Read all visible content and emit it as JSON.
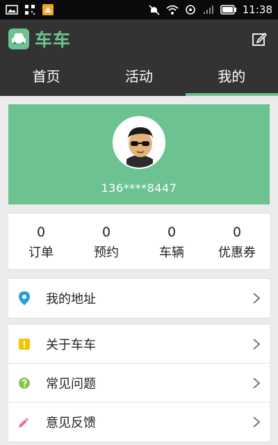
{
  "status_bar": {
    "time": "11:38"
  },
  "app": {
    "title": "车车",
    "logo_text": "车车"
  },
  "tabs": [
    {
      "label": "首页",
      "active": false
    },
    {
      "label": "活动",
      "active": false
    },
    {
      "label": "我的",
      "active": true
    }
  ],
  "profile": {
    "phone": "136****8447"
  },
  "stats": [
    {
      "value": "0",
      "label": "订单"
    },
    {
      "value": "0",
      "label": "预约"
    },
    {
      "value": "0",
      "label": "车辆"
    },
    {
      "value": "0",
      "label": "优惠券"
    }
  ],
  "menu_address": {
    "label": "我的地址",
    "icon": "location-pin-icon"
  },
  "menu_main": [
    {
      "label": "关于车车",
      "icon": "info-icon"
    },
    {
      "label": "常见问题",
      "icon": "question-icon"
    },
    {
      "label": "意见反馈",
      "icon": "pencil-icon"
    }
  ],
  "colors": {
    "accent": "#6cc391",
    "header": "#333333",
    "pin": "#2a9fd8",
    "info": "#f5c400",
    "question": "#8bc34a",
    "feedback": "#f06aa5"
  }
}
